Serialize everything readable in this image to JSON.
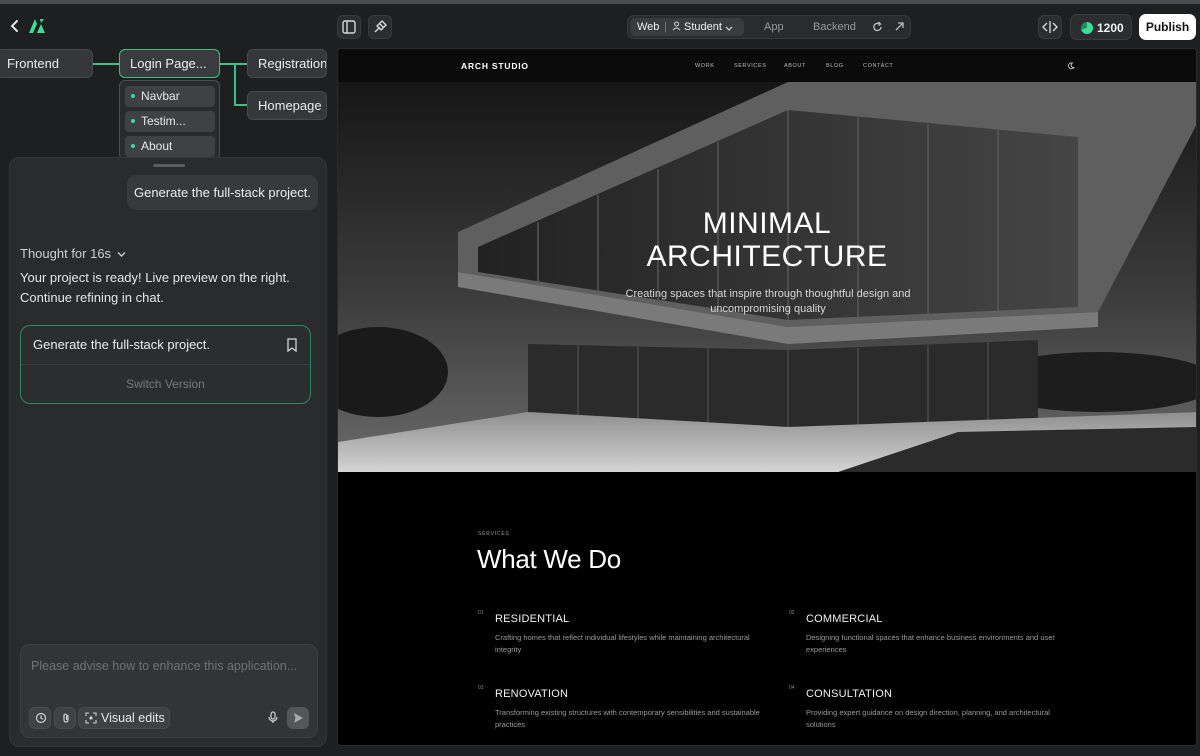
{
  "topbar": {
    "view_modes": {
      "web": "Web",
      "separator": "|",
      "student": "Student",
      "app": "App",
      "backend": "Backend"
    },
    "credits": "1200",
    "publish_label": "Publish"
  },
  "flow": {
    "nodes": {
      "frontend": "Frontend",
      "login": "Login Page...",
      "registration": "Registration...",
      "homepage": "Homepage"
    },
    "sections": [
      "Navbar",
      "Testim...",
      "About"
    ]
  },
  "chat": {
    "user_message": "Generate the full-stack project.",
    "thought_label": "Thought for 16s",
    "reply_line1": "Your project is ready! Live preview on the right.",
    "reply_line2": "Continue refining in chat.",
    "version_title": "Generate the full-stack project.",
    "switch_version": "Switch Version",
    "input_placeholder": "Please advise how to enhance this application...",
    "visual_edits": "Visual edits"
  },
  "site": {
    "brand": "ARCH STUDIO",
    "nav": [
      "WORK",
      "SERVICES",
      "ABOUT",
      "BLOG",
      "CONTACT"
    ],
    "hero_title_1": "MINIMAL",
    "hero_title_2": "ARCHITECTURE",
    "hero_subtitle": "Creating spaces that inspire through thoughtful design and uncompromising quality",
    "services_label": "SERVICES",
    "services_heading": "What We Do",
    "services": [
      {
        "num": "01",
        "title": "RESIDENTIAL",
        "desc": "Crafting homes that reflect individual lifestyles while maintaining architectural integrity"
      },
      {
        "num": "02",
        "title": "COMMERCIAL",
        "desc": "Designing functional spaces that enhance business environments and user experiences"
      },
      {
        "num": "03",
        "title": "RENOVATION",
        "desc": "Transforming existing structures with contemporary sensibilities and sustainable practices"
      },
      {
        "num": "04",
        "title": "CONSULTATION",
        "desc": "Providing expert guidance on design direction, planning, and architectural solutions"
      }
    ]
  },
  "colors": {
    "accent": "#3ddc97",
    "background": "#1e1f21",
    "panel": "#2a2b2d"
  }
}
